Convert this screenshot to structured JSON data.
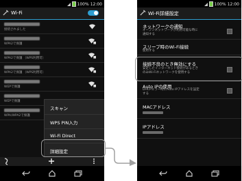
{
  "left": {
    "status": {
      "battery": "100%",
      "time": "12:00"
    },
    "actionbar": {
      "title": "Wi-Fi"
    },
    "networks": [
      {
        "subtitle": "接続されました"
      },
      {
        "subtitle": "WPA2で保護"
      },
      {
        "subtitle": "WPA2で保護 （WPS利用可）"
      },
      {
        "subtitle": "WPA2で保護 （WPS利用可）"
      },
      {
        "subtitle": "WEPで保護"
      },
      {
        "subtitle": "WEPで保護"
      },
      {
        "subtitle": "WPA/WPA2で保護"
      }
    ],
    "menu": {
      "items": [
        "スキャン",
        "WPS PIN入力",
        "Wi-Fi Direct",
        "詳細設定"
      ]
    }
  },
  "right": {
    "status": {
      "battery": "100%",
      "time": "12:00"
    },
    "actionbar": {
      "title": "Wi-Fi詳細設定"
    },
    "settings": [
      {
        "title": "ネットワークの通知",
        "subtitle1": "オープンネットワークが利用可能な時に",
        "subtitle2": "通知する"
      },
      {
        "title": "スリープ時のWi-Fi接続",
        "subtitle1": "使用する"
      },
      {
        "title": "接続不良のとき無効にする",
        "subtitle1": "安定したインターネット接続があるとき",
        "subtitle2": "のみWi-Fiネットワークを使用する"
      },
      {
        "title": "Auto IPの使用",
        "subtitle1": "DHCPエラー時にAuto IPアドレスを設定",
        "subtitle2": "する"
      },
      {
        "title": "MACアドレス"
      },
      {
        "title": "IPアドレス"
      }
    ]
  }
}
